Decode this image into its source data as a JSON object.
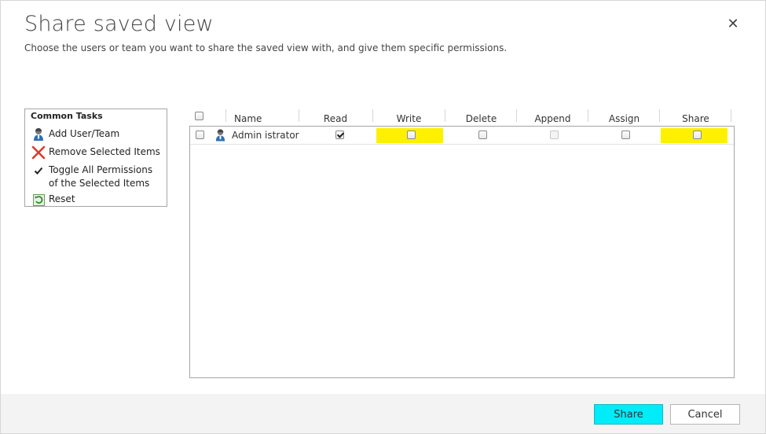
{
  "dialog": {
    "title": "Share saved view",
    "subtitle": "Choose the users or team you want to share the saved view with, and give them specific permissions.",
    "close_glyph": "✕"
  },
  "tasks": {
    "heading": "Common Tasks",
    "items": [
      {
        "label": "Add User/Team",
        "icon": "user-icon"
      },
      {
        "label": "Remove Selected Items",
        "icon": "remove-x-icon"
      },
      {
        "label": "Toggle All Permissions of the Selected Items",
        "icon": "checkmark-icon"
      },
      {
        "label": "Reset",
        "icon": "reset-icon"
      }
    ]
  },
  "grid": {
    "columns": [
      "Name",
      "Read",
      "Write",
      "Delete",
      "Append",
      "Assign",
      "Share"
    ],
    "rows": [
      {
        "name": "Admin istrator",
        "icon": "user-icon",
        "permissions": {
          "read": true,
          "write": false,
          "delete": false,
          "append": false,
          "assign": false,
          "share": false
        },
        "append_disabled": true,
        "highlighted": [
          "Write",
          "Share"
        ]
      }
    ],
    "highlight_color": "#fff000"
  },
  "footer": {
    "share_label": "Share",
    "cancel_label": "Cancel",
    "share_color": "#00ecf9"
  }
}
